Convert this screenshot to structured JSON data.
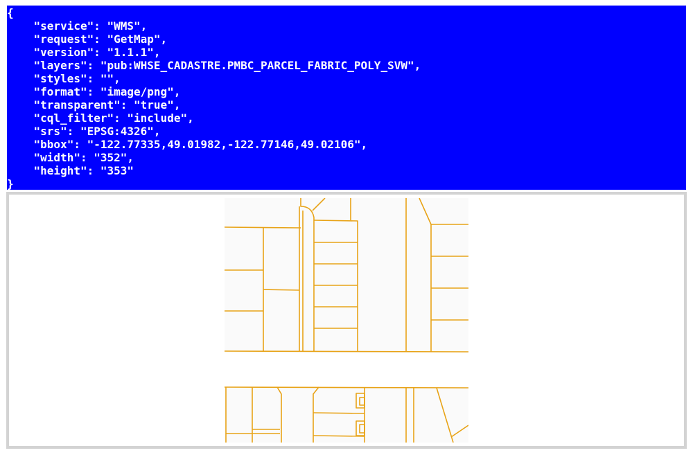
{
  "request_json": {
    "open_brace": "{",
    "lines": [
      "    \"service\": \"WMS\",",
      "    \"request\": \"GetMap\",",
      "    \"version\": \"1.1.1\",",
      "    \"layers\": \"pub:WHSE_CADASTRE.PMBC_PARCEL_FABRIC_POLY_SVW\",",
      "    \"styles\": \"\",",
      "    \"format\": \"image/png\",",
      "    \"transparent\": \"true\",",
      "    \"cql_filter\": \"include\",",
      "    \"srs\": \"EPSG:4326\",",
      "    \"bbox\": \"-122.77335,49.01982,-122.77146,49.02106\",",
      "    \"width\": \"352\",",
      "    \"height\": \"353\""
    ],
    "close_brace": "}"
  },
  "colors": {
    "panel_background": "#0000ff",
    "panel_text": "#ffffff",
    "parcel_outline": "#e8a317",
    "parcel_fill": "#fafafa",
    "frame_border": "#d3d3d3"
  }
}
